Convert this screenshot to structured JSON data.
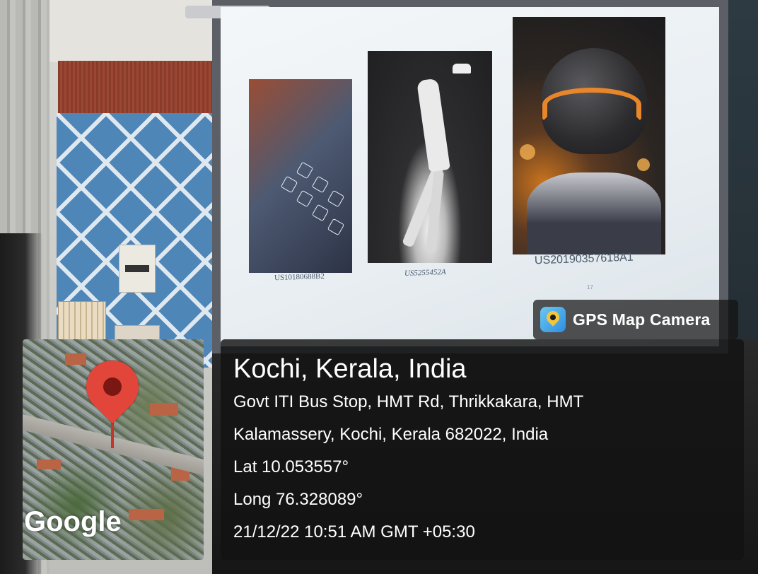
{
  "slide": {
    "captions": [
      "US10180688B2",
      "US5255452A",
      "US20190357618A1"
    ],
    "slide_number": "17"
  },
  "overlay": {
    "app_label": "GPS Map Camera",
    "map_brand": "Google",
    "location_title": "Kochi, Kerala, India",
    "address_line1": "Govt ITI Bus Stop, HMT Rd, Thrikkakara, HMT",
    "address_line2": "Kalamassery, Kochi, Kerala 682022, India",
    "latitude": "Lat 10.053557°",
    "longitude": "Long 76.328089°",
    "timestamp": "21/12/22 10:51 AM GMT +05:30",
    "pin_color": "#e2463a"
  }
}
